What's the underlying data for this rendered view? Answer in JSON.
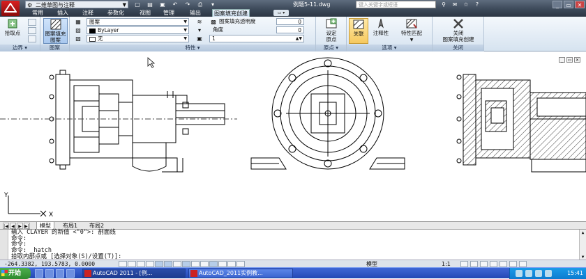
{
  "title_bar": {
    "workspace": "二维草图与注释",
    "document_title": "例题5-11.dwg",
    "search_placeholder": "键入关键字或短语"
  },
  "ribbon_tabs": [
    "常用",
    "插入",
    "注释",
    "参数化",
    "视图",
    "管理",
    "输出",
    "图案填充创建"
  ],
  "ribbon": {
    "boundary": {
      "pick_points": "拾取点",
      "title": "边界"
    },
    "pattern": {
      "label_line1": "图案填充",
      "label_line2": "图案",
      "title": "图案"
    },
    "properties": {
      "type_value": "图案",
      "color_value": "ByLayer",
      "background_value": "无",
      "transparency_label": "图案填充透明度",
      "transparency_value": "0",
      "angle_label": "角度",
      "angle_value": "0",
      "scale_value": "1",
      "title": "特性"
    },
    "origin": {
      "label_line1": "设定",
      "label_line2": "原点",
      "title": "原点"
    },
    "options": {
      "associative": "关联",
      "annotative": "注释性",
      "match_properties": "特性匹配",
      "title": "选项"
    },
    "close": {
      "label_line1": "关闭",
      "label_line2": "图案填充创建",
      "title": "关闭"
    }
  },
  "layout_tabs": [
    "模型",
    "布局1",
    "布局2"
  ],
  "command_lines": [
    "输入 CLAYER 的新值 <\"0\">: 剖面线",
    "命令:",
    "命令:",
    "命令: _hatch",
    "拾取内部点或 [选择对象(S)/设置(T)]:"
  ],
  "status_bar": {
    "coordinates": "-264.3382, 193.5783, 0.0000",
    "model_label": "模型",
    "annotation_scale": "1:1"
  },
  "taskbar": {
    "start_label": "开始",
    "tasks": [
      "AutoCAD 2011 - [例...",
      "AutoCAD_2011实例教..."
    ],
    "clock": "15:41"
  },
  "ucs": {
    "x_label": "X",
    "y_label": "Y"
  },
  "colors": {
    "title_bar": "#3d4a5a",
    "ribbon": "#d6e3f0",
    "taskbar": "#2448b5",
    "active_task": "#1d3c90"
  }
}
